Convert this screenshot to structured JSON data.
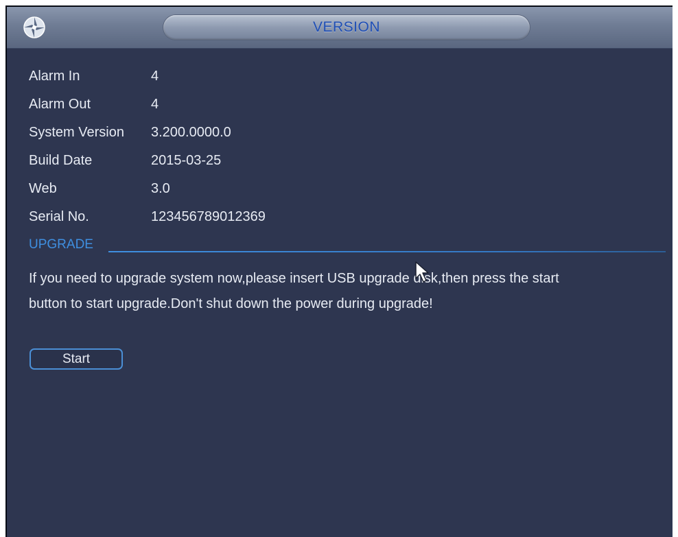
{
  "window": {
    "title": "VERSION"
  },
  "info": [
    {
      "label": "Alarm In",
      "value": "4"
    },
    {
      "label": "Alarm Out",
      "value": "4"
    },
    {
      "label": "System Version",
      "value": "3.200.0000.0"
    },
    {
      "label": "Build Date",
      "value": "2015-03-25"
    },
    {
      "label": "Web",
      "value": "3.0"
    },
    {
      "label": "Serial No.",
      "value": "123456789012369"
    }
  ],
  "upgrade": {
    "section_label": "UPGRADE",
    "message_line1": "If you need to upgrade system now,please insert USB upgrade disk,then press the start",
    "message_line2": "button to start upgrade.Don't shut down the power during upgrade!",
    "start_label": "Start"
  },
  "icons": {
    "logo": "dahua-logo-icon",
    "cursor": "mouse-pointer-icon"
  },
  "colors": {
    "background": "#2e3650",
    "title_text": "#1f4fb6",
    "section_accent": "#3f8fe0",
    "text": "#e7ebf3"
  }
}
